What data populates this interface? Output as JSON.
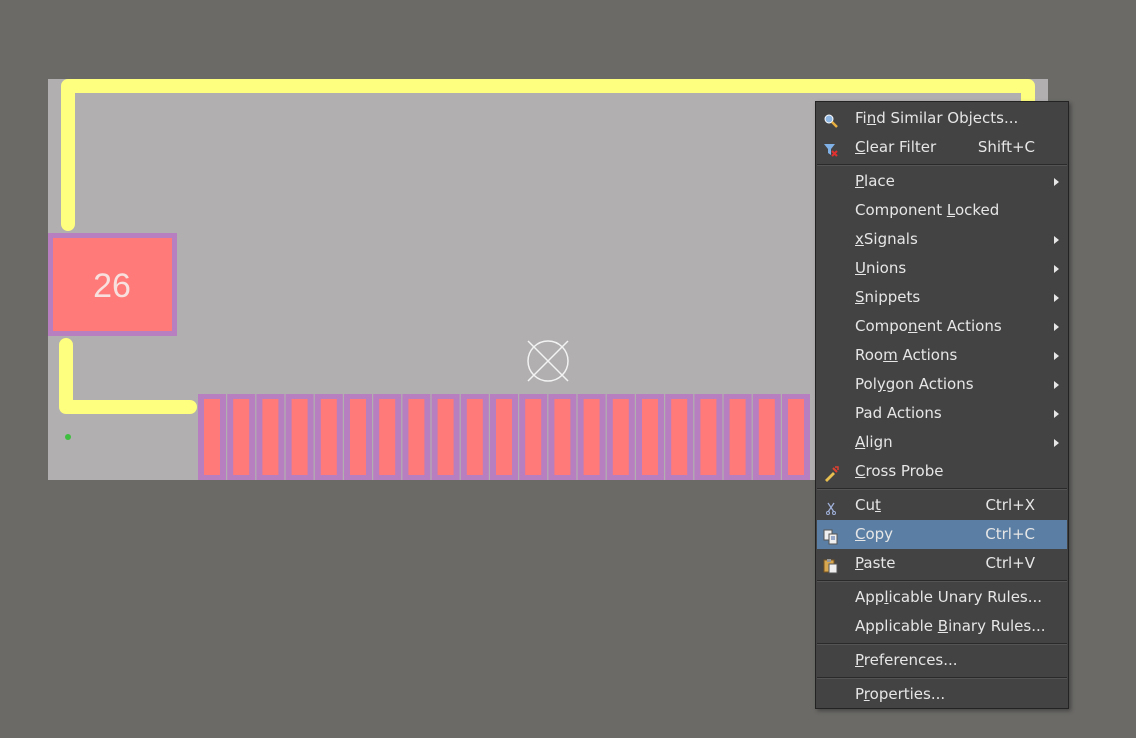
{
  "pcb": {
    "pad_large_label": "26",
    "colors": {
      "workspace": "#6b6a67",
      "board": "#b1afaf",
      "track": "#fefe7f",
      "pad_fill": "#ff7a78",
      "pad_outline": "#b87fc0"
    },
    "small_pad_count": 21
  },
  "context_menu": {
    "items": [
      {
        "id": "find-similar-objects",
        "label": "Find Similar Objects...",
        "mnemonic": "n",
        "icon": "magnifier-icon",
        "submenu": false
      },
      {
        "id": "clear-filter",
        "label": "Clear Filter",
        "mnemonic": "C",
        "icon": "filter-clear-icon",
        "shortcut": "Shift+C",
        "submenu": false
      },
      {
        "id": "place",
        "label": "Place",
        "mnemonic": "P",
        "submenu": true
      },
      {
        "id": "component-locked",
        "label": "Component Locked",
        "mnemonic": "L",
        "submenu": false
      },
      {
        "id": "xsignals",
        "label": "xSignals",
        "mnemonic": "x",
        "submenu": true
      },
      {
        "id": "unions",
        "label": "Unions",
        "mnemonic": "U",
        "submenu": true
      },
      {
        "id": "snippets",
        "label": "Snippets",
        "mnemonic": "S",
        "submenu": true
      },
      {
        "id": "component-actions",
        "label": "Component Actions",
        "mnemonic": "n",
        "submenu": true
      },
      {
        "id": "room-actions",
        "label": "Room Actions",
        "mnemonic": "m",
        "submenu": true
      },
      {
        "id": "polygon-actions",
        "label": "Polygon Actions",
        "mnemonic": "y",
        "submenu": true
      },
      {
        "id": "pad-actions",
        "label": "Pad Actions",
        "mnemonic": "",
        "submenu": true
      },
      {
        "id": "align",
        "label": "Align",
        "mnemonic": "A",
        "submenu": true
      },
      {
        "id": "cross-probe",
        "label": "Cross Probe",
        "mnemonic": "C",
        "icon": "cross-probe-icon",
        "submenu": false
      },
      {
        "id": "cut",
        "label": "Cut",
        "mnemonic": "t",
        "icon": "scissors-icon",
        "shortcut": "Ctrl+X",
        "submenu": false
      },
      {
        "id": "copy",
        "label": "Copy",
        "mnemonic": "C",
        "icon": "copy-icon",
        "shortcut": "Ctrl+C",
        "submenu": false,
        "highlighted": true
      },
      {
        "id": "paste",
        "label": "Paste",
        "mnemonic": "P",
        "icon": "paste-icon",
        "shortcut": "Ctrl+V",
        "submenu": false
      },
      {
        "id": "applicable-unary-rules",
        "label": "Applicable Unary Rules...",
        "mnemonic": "l",
        "submenu": false
      },
      {
        "id": "applicable-binary-rules",
        "label": "Applicable Binary Rules...",
        "mnemonic": "B",
        "submenu": false
      },
      {
        "id": "preferences",
        "label": "Preferences...",
        "mnemonic": "P",
        "submenu": false
      },
      {
        "id": "properties",
        "label": "Properties...",
        "mnemonic": "r",
        "submenu": false
      }
    ],
    "highlight_color": "#5b7fa4",
    "background_color": "#434343"
  }
}
